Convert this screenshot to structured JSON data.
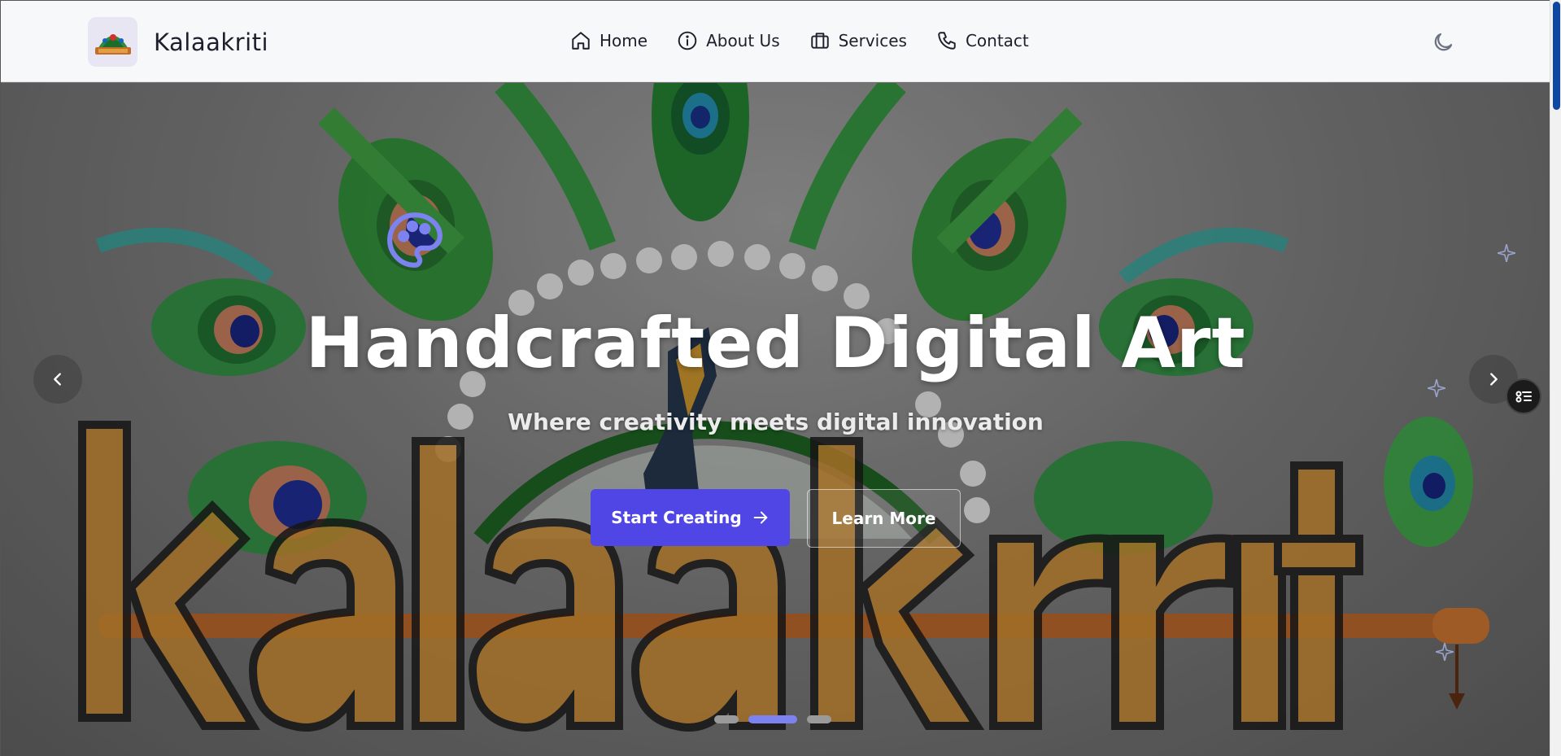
{
  "header": {
    "brand_name": "Kalaakriti",
    "nav": [
      {
        "label": "Home",
        "icon": "home-icon"
      },
      {
        "label": "About Us",
        "icon": "info-icon"
      },
      {
        "label": "Services",
        "icon": "briefcase-icon"
      },
      {
        "label": "Contact",
        "icon": "phone-icon"
      }
    ],
    "theme_toggle_icon": "moon-icon"
  },
  "hero": {
    "title": "Handcrafted Digital Art",
    "subtitle": "Where creativity meets digital innovation",
    "primary_cta": "Start Creating",
    "secondary_cta": "Learn More",
    "badge_icon": "palette-icon",
    "background_text": "kalaakriti",
    "slides_total": 3,
    "active_slide": 2
  },
  "colors": {
    "accent": "#4f46e5",
    "active_dot": "#7c83f0",
    "scroll_thumb": "#0d47a1"
  }
}
